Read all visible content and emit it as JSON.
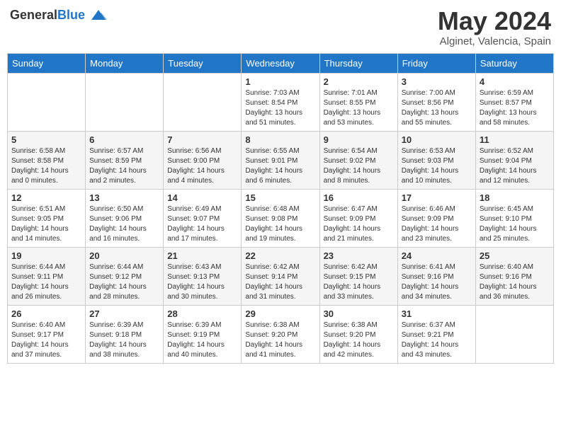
{
  "header": {
    "logo_general": "General",
    "logo_blue": "Blue",
    "month_year": "May 2024",
    "location": "Alginet, Valencia, Spain"
  },
  "weekdays": [
    "Sunday",
    "Monday",
    "Tuesday",
    "Wednesday",
    "Thursday",
    "Friday",
    "Saturday"
  ],
  "weeks": [
    [
      {
        "day": "",
        "info": ""
      },
      {
        "day": "",
        "info": ""
      },
      {
        "day": "",
        "info": ""
      },
      {
        "day": "1",
        "info": "Sunrise: 7:03 AM\nSunset: 8:54 PM\nDaylight: 13 hours\nand 51 minutes."
      },
      {
        "day": "2",
        "info": "Sunrise: 7:01 AM\nSunset: 8:55 PM\nDaylight: 13 hours\nand 53 minutes."
      },
      {
        "day": "3",
        "info": "Sunrise: 7:00 AM\nSunset: 8:56 PM\nDaylight: 13 hours\nand 55 minutes."
      },
      {
        "day": "4",
        "info": "Sunrise: 6:59 AM\nSunset: 8:57 PM\nDaylight: 13 hours\nand 58 minutes."
      }
    ],
    [
      {
        "day": "5",
        "info": "Sunrise: 6:58 AM\nSunset: 8:58 PM\nDaylight: 14 hours\nand 0 minutes."
      },
      {
        "day": "6",
        "info": "Sunrise: 6:57 AM\nSunset: 8:59 PM\nDaylight: 14 hours\nand 2 minutes."
      },
      {
        "day": "7",
        "info": "Sunrise: 6:56 AM\nSunset: 9:00 PM\nDaylight: 14 hours\nand 4 minutes."
      },
      {
        "day": "8",
        "info": "Sunrise: 6:55 AM\nSunset: 9:01 PM\nDaylight: 14 hours\nand 6 minutes."
      },
      {
        "day": "9",
        "info": "Sunrise: 6:54 AM\nSunset: 9:02 PM\nDaylight: 14 hours\nand 8 minutes."
      },
      {
        "day": "10",
        "info": "Sunrise: 6:53 AM\nSunset: 9:03 PM\nDaylight: 14 hours\nand 10 minutes."
      },
      {
        "day": "11",
        "info": "Sunrise: 6:52 AM\nSunset: 9:04 PM\nDaylight: 14 hours\nand 12 minutes."
      }
    ],
    [
      {
        "day": "12",
        "info": "Sunrise: 6:51 AM\nSunset: 9:05 PM\nDaylight: 14 hours\nand 14 minutes."
      },
      {
        "day": "13",
        "info": "Sunrise: 6:50 AM\nSunset: 9:06 PM\nDaylight: 14 hours\nand 16 minutes."
      },
      {
        "day": "14",
        "info": "Sunrise: 6:49 AM\nSunset: 9:07 PM\nDaylight: 14 hours\nand 17 minutes."
      },
      {
        "day": "15",
        "info": "Sunrise: 6:48 AM\nSunset: 9:08 PM\nDaylight: 14 hours\nand 19 minutes."
      },
      {
        "day": "16",
        "info": "Sunrise: 6:47 AM\nSunset: 9:09 PM\nDaylight: 14 hours\nand 21 minutes."
      },
      {
        "day": "17",
        "info": "Sunrise: 6:46 AM\nSunset: 9:09 PM\nDaylight: 14 hours\nand 23 minutes."
      },
      {
        "day": "18",
        "info": "Sunrise: 6:45 AM\nSunset: 9:10 PM\nDaylight: 14 hours\nand 25 minutes."
      }
    ],
    [
      {
        "day": "19",
        "info": "Sunrise: 6:44 AM\nSunset: 9:11 PM\nDaylight: 14 hours\nand 26 minutes."
      },
      {
        "day": "20",
        "info": "Sunrise: 6:44 AM\nSunset: 9:12 PM\nDaylight: 14 hours\nand 28 minutes."
      },
      {
        "day": "21",
        "info": "Sunrise: 6:43 AM\nSunset: 9:13 PM\nDaylight: 14 hours\nand 30 minutes."
      },
      {
        "day": "22",
        "info": "Sunrise: 6:42 AM\nSunset: 9:14 PM\nDaylight: 14 hours\nand 31 minutes."
      },
      {
        "day": "23",
        "info": "Sunrise: 6:42 AM\nSunset: 9:15 PM\nDaylight: 14 hours\nand 33 minutes."
      },
      {
        "day": "24",
        "info": "Sunrise: 6:41 AM\nSunset: 9:16 PM\nDaylight: 14 hours\nand 34 minutes."
      },
      {
        "day": "25",
        "info": "Sunrise: 6:40 AM\nSunset: 9:16 PM\nDaylight: 14 hours\nand 36 minutes."
      }
    ],
    [
      {
        "day": "26",
        "info": "Sunrise: 6:40 AM\nSunset: 9:17 PM\nDaylight: 14 hours\nand 37 minutes."
      },
      {
        "day": "27",
        "info": "Sunrise: 6:39 AM\nSunset: 9:18 PM\nDaylight: 14 hours\nand 38 minutes."
      },
      {
        "day": "28",
        "info": "Sunrise: 6:39 AM\nSunset: 9:19 PM\nDaylight: 14 hours\nand 40 minutes."
      },
      {
        "day": "29",
        "info": "Sunrise: 6:38 AM\nSunset: 9:20 PM\nDaylight: 14 hours\nand 41 minutes."
      },
      {
        "day": "30",
        "info": "Sunrise: 6:38 AM\nSunset: 9:20 PM\nDaylight: 14 hours\nand 42 minutes."
      },
      {
        "day": "31",
        "info": "Sunrise: 6:37 AM\nSunset: 9:21 PM\nDaylight: 14 hours\nand 43 minutes."
      },
      {
        "day": "",
        "info": ""
      }
    ]
  ]
}
